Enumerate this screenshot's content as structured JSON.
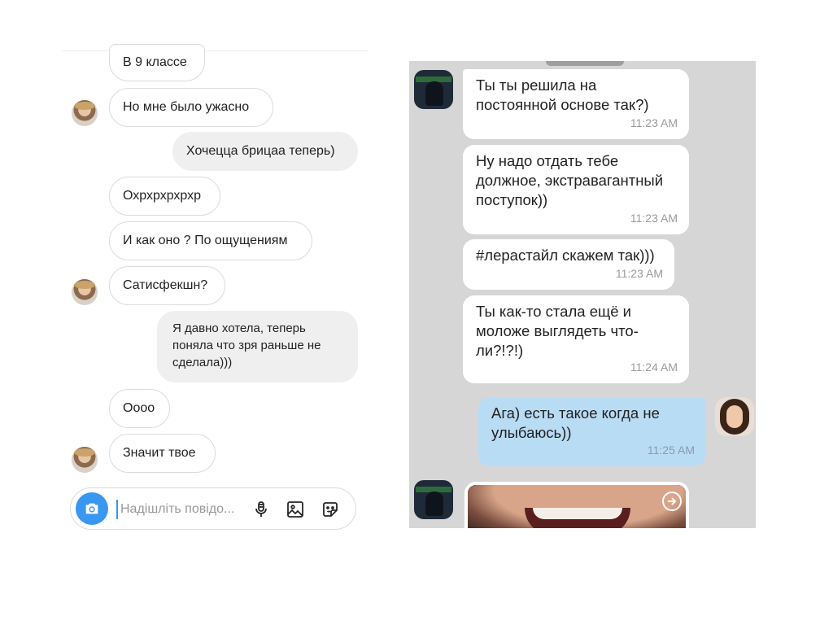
{
  "left": {
    "messages": [
      {
        "text": "В 9 классе",
        "side": "in"
      },
      {
        "text": "Но мне было ужасно",
        "side": "in"
      },
      {
        "text": "Хочецца брицаа теперь)",
        "side": "out"
      },
      {
        "text": "Охрхрхрхрхр",
        "side": "in"
      },
      {
        "text": "И как оно ? По ощущениям",
        "side": "in"
      },
      {
        "text": "Сатисфекшн?",
        "side": "in"
      },
      {
        "text": "Я давно хотела, теперь поняла что зря раньше не сделала)))",
        "side": "out"
      },
      {
        "text": "Оооо",
        "side": "in"
      },
      {
        "text": "Значит твое",
        "side": "in"
      }
    ],
    "composer": {
      "placeholder": "Надішліть повідо..."
    },
    "icons": {
      "camera": "camera-icon",
      "mic": "microphone-icon",
      "gallery": "image-icon",
      "sticker": "sticker-icon"
    },
    "colors": {
      "accent": "#3897f0",
      "outgoing_bubble": "#efefef",
      "incoming_border": "#dbdbdb"
    }
  },
  "right": {
    "messages": [
      {
        "text": "Ты ты решила на постоянной основе так?)",
        "time": "11:23 AM",
        "side": "in"
      },
      {
        "text": "Ну надо отдать тебе должное, экстравагантный поступок))",
        "time": "11:23 AM",
        "side": "in"
      },
      {
        "text": "#лерастайл скажем так)))",
        "time": "11:23 AM",
        "side": "in"
      },
      {
        "text": "Ты как-то стала ещё и моложе выглядеть что-ли?!?!)",
        "time": "11:24 AM",
        "side": "in"
      },
      {
        "text": "Ага) есть такое когда не улыбаюсь))",
        "time": "11:25 AM",
        "side": "out"
      }
    ],
    "icons": {
      "share": "share-arrow-icon"
    },
    "colors": {
      "background": "#d6d6d6",
      "outgoing_bubble": "#b9dcf5",
      "incoming_bubble": "#ffffff"
    }
  }
}
